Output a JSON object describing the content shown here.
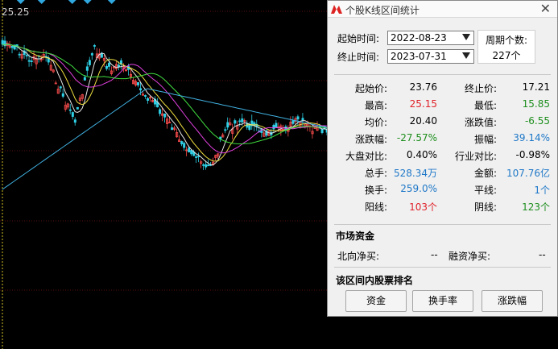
{
  "chart": {
    "price_label": "25.25",
    "colors": {
      "up": "#ff4d4d",
      "down": "#2fd0e6",
      "ma5": "#e6e6e6",
      "ma10": "#f0e040",
      "ma20": "#e040e0",
      "ma30": "#40e040",
      "ma60": "#40b0e0"
    }
  },
  "dialog": {
    "title": "个股K线区间统计",
    "close_icon": "close-icon",
    "start_label": "起始时间:",
    "start_value": "2022-08-23",
    "end_label": "终止时间:",
    "end_value": "2023-07-31",
    "period_label": "周期个数:",
    "period_value": "227个",
    "stats": [
      {
        "l1": "起始价:",
        "v1": "23.76",
        "c1": "",
        "l2": "终止价:",
        "v2": "17.21",
        "c2": ""
      },
      {
        "l1": "最高:",
        "v1": "25.15",
        "c1": "red",
        "l2": "最低:",
        "v2": "15.85",
        "c2": "green"
      },
      {
        "l1": "均价:",
        "v1": "20.40",
        "c1": "",
        "l2": "涨跌值:",
        "v2": "-6.55",
        "c2": "green"
      },
      {
        "l1": "涨跌幅:",
        "v1": "-27.57%",
        "c1": "green",
        "l2": "振幅:",
        "v2": "39.14%",
        "c2": "blue"
      },
      {
        "l1": "大盘对比:",
        "v1": "0.40%",
        "c1": "",
        "l2": "行业对比:",
        "v2": "-0.98%",
        "c2": ""
      },
      {
        "l1": "总手:",
        "v1": "528.34万",
        "c1": "blue",
        "l2": "金额:",
        "v2": "107.76亿",
        "c2": "blue"
      },
      {
        "l1": "换手:",
        "v1": "259.0%",
        "c1": "blue",
        "l2": "平线:",
        "v2": "1个",
        "c2": "blue"
      },
      {
        "l1": "阳线:",
        "v1": "103个",
        "c1": "red",
        "l2": "阴线:",
        "v2": "123个",
        "c2": "green"
      }
    ],
    "fund_section": "市场资金",
    "north_label": "北向净买:",
    "north_value": "--",
    "margin_label": "融资净买:",
    "margin_value": "--",
    "rank_section": "该区间内股票排名",
    "buttons": [
      "资金",
      "换手率",
      "涨跌幅"
    ]
  }
}
